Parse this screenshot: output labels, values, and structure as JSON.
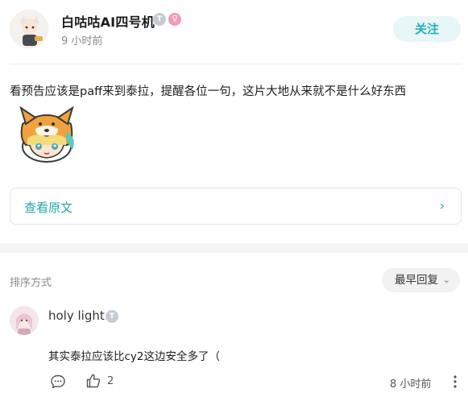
{
  "post": {
    "author_name": "白咕咕AI四号机",
    "level_badge": "T",
    "gender_badge": "♀",
    "time": "9 小时前",
    "follow_label": "关注",
    "text": "看预告应该是paff来到泰拉，提醒各位一句，这片大地从来就不是什么好东西",
    "view_original_label": "查看原文",
    "view_original_chevron": "›"
  },
  "comments_section": {
    "sort_label": "排序方式",
    "sort_value": "最早回复",
    "sort_chevron": "⌄"
  },
  "comments": [
    {
      "author": "holy light",
      "level_badge": "T",
      "text": "其实泰拉应该比cy2这边安全多了（",
      "likes": "2",
      "time": "8 小时前"
    }
  ],
  "colors": {
    "accent": "#1fb1b8",
    "follow_bg": "#e8f6f7",
    "gender_badge": "#f39ab4",
    "level_badge": "#c7ccd3"
  },
  "icons": {
    "reply": "speech-bubble-icon",
    "like": "thumbs-up-icon",
    "more": "more-vertical-icon"
  }
}
